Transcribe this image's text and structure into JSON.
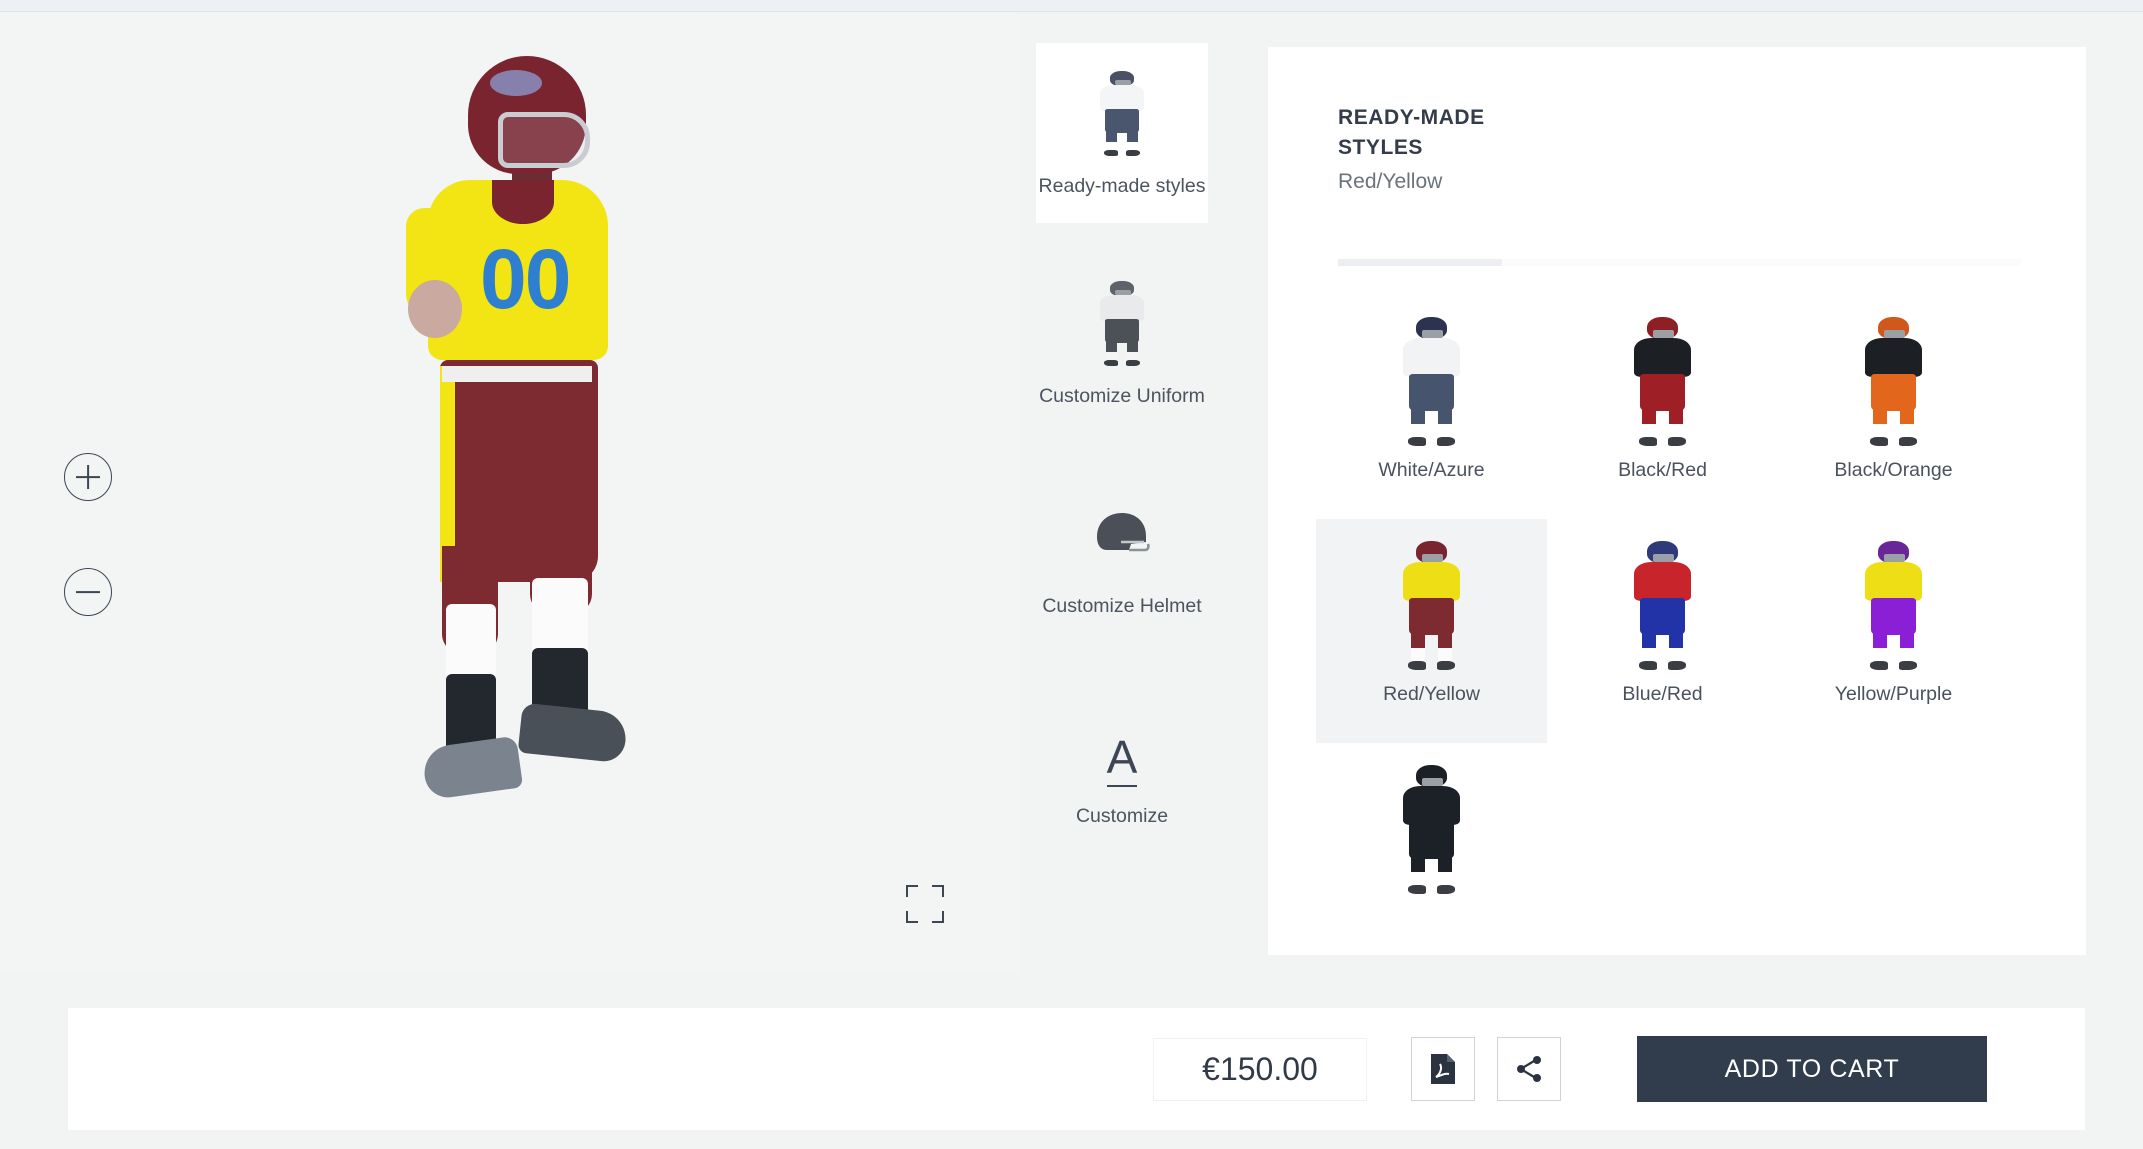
{
  "viewer": {
    "zoom_in_label": "+",
    "zoom_out_label": "−",
    "fullscreen_label": "Fullscreen",
    "model": {
      "jersey_number": "00"
    }
  },
  "rail": {
    "items": [
      {
        "label": "Ready-made styles",
        "icon": "player-white-icon",
        "active": true
      },
      {
        "label": "Customize Uniform",
        "icon": "player-gray-icon",
        "active": false
      },
      {
        "label": "Customize Helmet",
        "icon": "helmet-icon",
        "active": false
      },
      {
        "label": "Customize",
        "icon": "letter-a-icon",
        "active": false
      }
    ]
  },
  "panel": {
    "title": "READY-MADE STYLES",
    "subtitle": "Red/Yellow",
    "progress_percent": 24,
    "styles": [
      {
        "label": "White/Azure",
        "selected": false,
        "helmet": "#2b3350",
        "jersey": "#f2f3f5",
        "pants": "#47546d",
        "sock": "#ffffff",
        "low": "#22262c"
      },
      {
        "label": "Black/Red",
        "selected": false,
        "helmet": "#8e1f24",
        "jersey": "#1c1f24",
        "pants": "#9e2026",
        "sock": "#ffffff",
        "low": "#8e1f24"
      },
      {
        "label": "Black/Orange",
        "selected": false,
        "helmet": "#d1581b",
        "jersey": "#1c1f24",
        "pants": "#e2671c",
        "sock": "#ffffff",
        "low": "#22262c"
      },
      {
        "label": "Red/Yellow",
        "selected": true,
        "helmet": "#7a2430",
        "jersey": "#eede16",
        "pants": "#7d2b31",
        "sock": "#fbfbfb",
        "low": "#e4d516"
      },
      {
        "label": "Blue/Red",
        "selected": false,
        "helmet": "#2f3a7a",
        "jersey": "#c8242c",
        "pants": "#2233a8",
        "sock": "#ffffff",
        "low": "#c8242c"
      },
      {
        "label": "Yellow/Purple",
        "selected": false,
        "helmet": "#6a2596",
        "jersey": "#eede16",
        "pants": "#8b1fd6",
        "sock": "#ffffff",
        "low": "#e4d516"
      },
      {
        "label": "",
        "selected": false,
        "helmet": "#1c1f24",
        "jersey": "#1c2127",
        "pants": "#1c2127",
        "sock": "#ffffff",
        "low": "#1c1f24"
      }
    ]
  },
  "bottom_bar": {
    "price": "€150.00",
    "pdf_label": "Download PDF",
    "share_label": "Share",
    "add_to_cart_label": "ADD TO CART"
  },
  "colors": {
    "page_bg": "#f2f3f3",
    "panel_bg": "#ffffff",
    "accent_dark": "#313d4d",
    "text": "#3c4654",
    "selected_bg": "#f2f3f5"
  }
}
